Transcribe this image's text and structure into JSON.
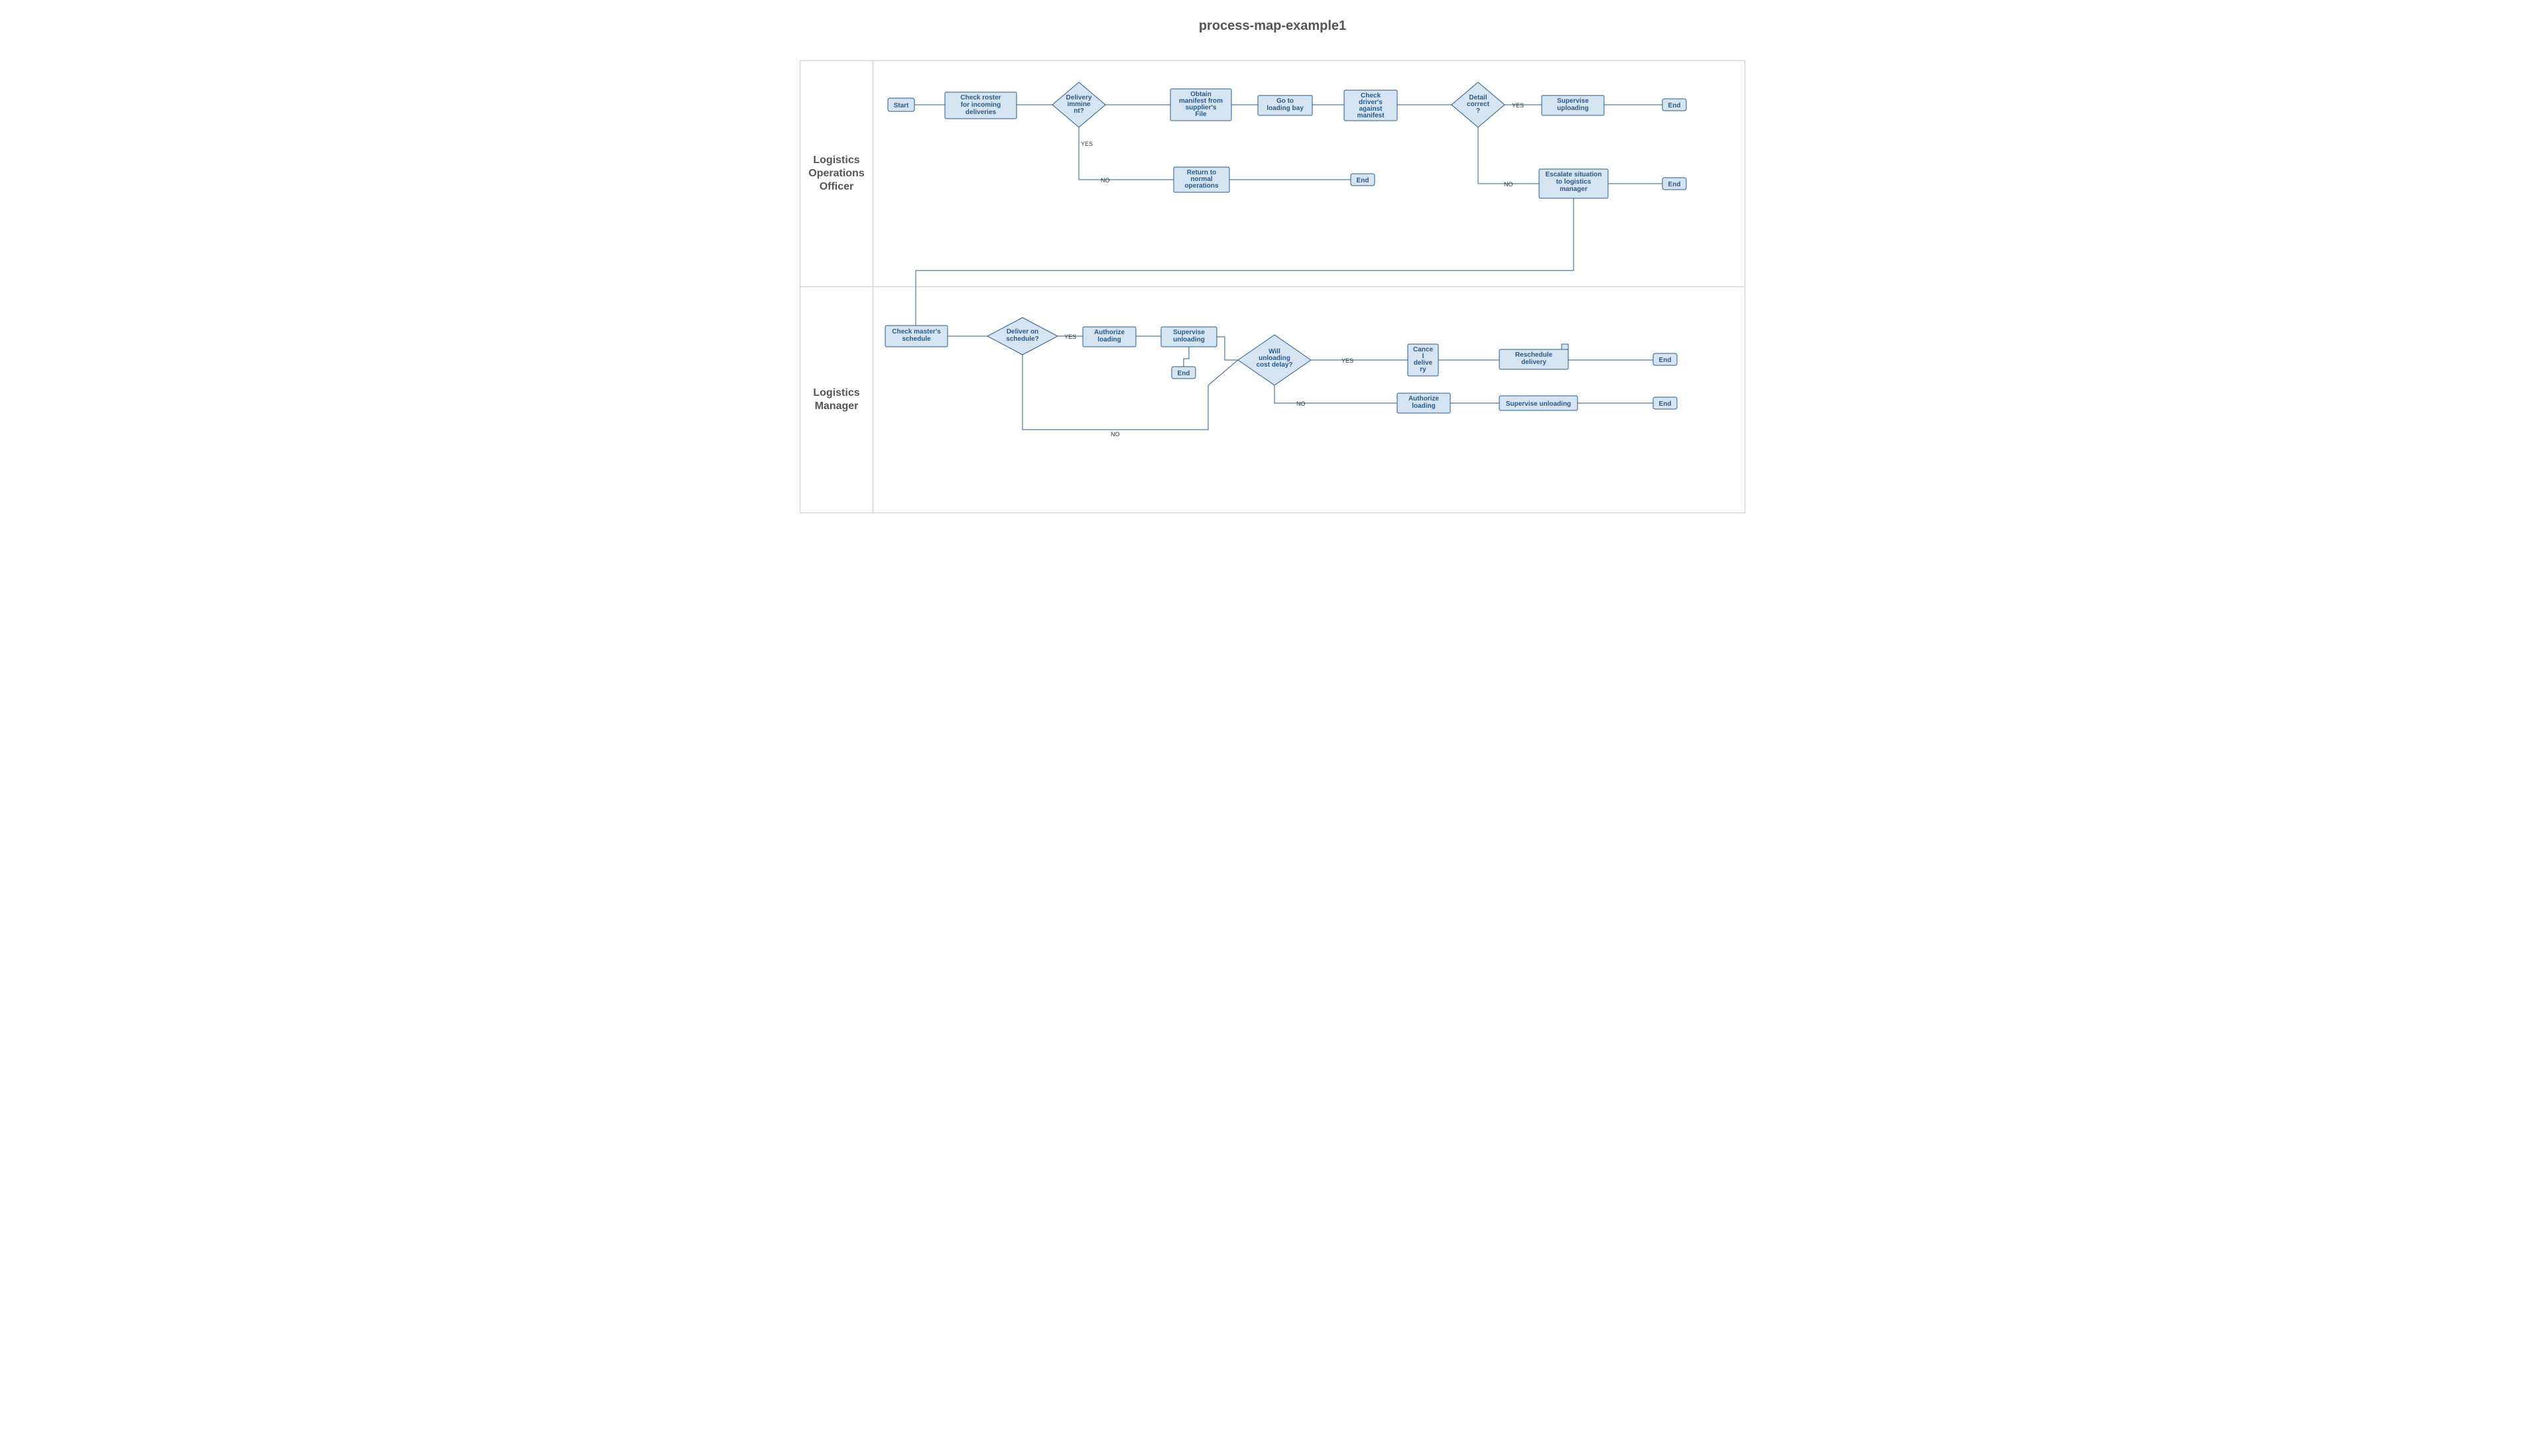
{
  "title": "process-map-example1",
  "lanes": {
    "logisticsOfficer": {
      "label": "Logistics Operations Officer"
    },
    "logisticsManager": {
      "label": "Logistics Manager"
    }
  },
  "nodes": {
    "start": "Start",
    "checkRoster": "Check roster for incoming deliveries",
    "deliveryImminent": "Delivery imminent?",
    "obtainManifest": "Obtain manifest from supplier's File",
    "gotoLoadingBay": "Go to loading bay",
    "checkDrivers": "Check driver's against manifest",
    "detailCorrect": "Detail correct?",
    "superviseUploading": "Supervise uploading",
    "end1": "End",
    "returnNormal": "Return to normal operations",
    "end2": "End",
    "escalate": "Escalate situation to logistics manager",
    "end3": "End",
    "checkMasterSchedule": "Check master's schedule",
    "deliverOnSchedule": "Deliver on schedule?",
    "authorizeLoading1": "Authorize loading",
    "superviseUnloading1": "Supervise unloading",
    "end4": "End",
    "willUnloadingCostDelay": "Will unloading cost delay?",
    "cancelDelivery": "Cancel delivery",
    "rescheduleDelivery": "Reschedule delivery",
    "end5": "End",
    "authorizeLoading2": "Authorize loading",
    "superviseUnloading2": "Supervise unloading",
    "end6": "End"
  },
  "edgeLabels": {
    "yes": "YES",
    "no": "NO"
  }
}
